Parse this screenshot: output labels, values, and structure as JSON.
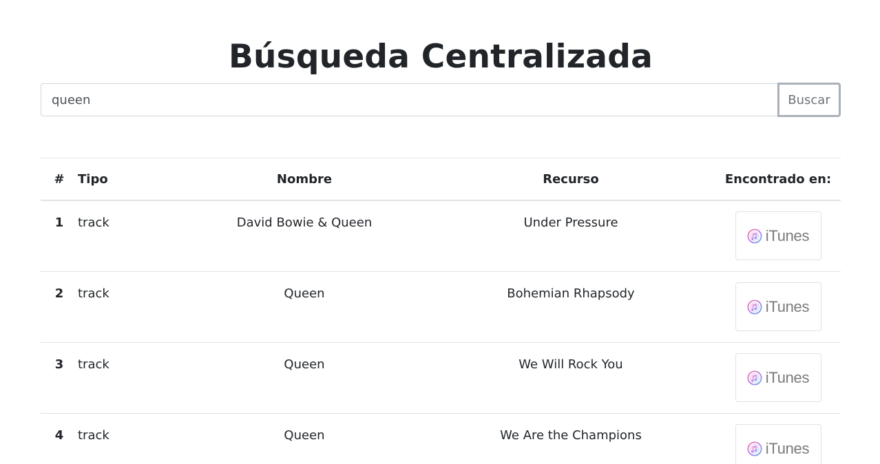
{
  "page": {
    "title": "Búsqueda Centralizada"
  },
  "search": {
    "value": "queen",
    "button_label": "Buscar"
  },
  "table": {
    "headers": [
      "#",
      "Tipo",
      "Nombre",
      "Recurso",
      "Encontrado en:"
    ],
    "rows": [
      {
        "num": "1",
        "tipo": "track",
        "nombre": "David Bowie & Queen",
        "recurso": "Under Pressure",
        "source": "iTunes"
      },
      {
        "num": "2",
        "tipo": "track",
        "nombre": "Queen",
        "recurso": "Bohemian Rhapsody",
        "source": "iTunes"
      },
      {
        "num": "3",
        "tipo": "track",
        "nombre": "Queen",
        "recurso": "We Will Rock You",
        "source": "iTunes"
      },
      {
        "num": "4",
        "tipo": "track",
        "nombre": "Queen",
        "recurso": "We Are the Champions",
        "source": "iTunes"
      }
    ]
  },
  "icons": {
    "source_logo": "itunes-logo-icon"
  },
  "colors": {
    "text": "#212529",
    "border": "#dee2e6",
    "muted": "#6c757d"
  }
}
